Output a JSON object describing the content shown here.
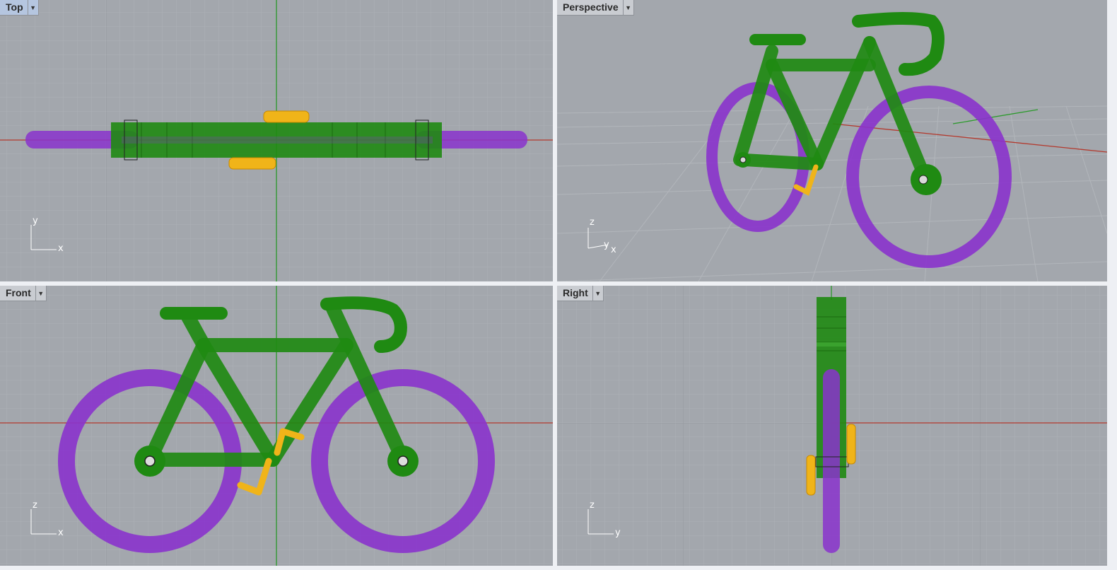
{
  "viewports": {
    "top": {
      "title": "Top",
      "axis_h": "x",
      "axis_v": "y"
    },
    "perspective": {
      "title": "Perspective",
      "axis_a": "z",
      "axis_b": "y",
      "axis_c": "x"
    },
    "front": {
      "title": "Front",
      "axis_h": "x",
      "axis_v": "z"
    },
    "right": {
      "title": "Right",
      "axis_h": "y",
      "axis_v": "z"
    }
  },
  "dropdown_icon": "caret-down-icon",
  "colors": {
    "viewport_bg": "#a3a7ad",
    "grid_minor": "#aeb2b7",
    "grid_major": "#979ba1",
    "x_axis": "#b33a2e",
    "y_axis": "#2c9a2c",
    "frame": "#1f8a12",
    "wheel": "#8a33cc",
    "crank_selected": "#f0b419",
    "active_tab": "#b5c6e0"
  }
}
